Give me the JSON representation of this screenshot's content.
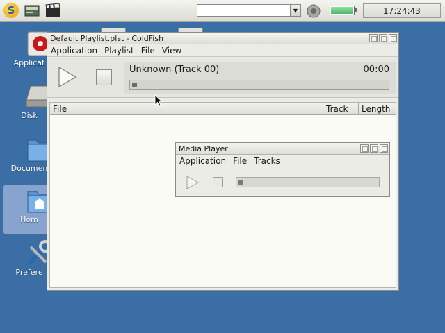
{
  "panel": {
    "clock": "17:24:43",
    "start_logo": "S",
    "combo_value": "",
    "battery_level": 1.0,
    "icons": [
      "start-menu-icon",
      "file-manager-icon",
      "video-clapper-icon",
      "sound-icon",
      "battery-icon"
    ]
  },
  "desktop": {
    "icons": [
      {
        "label": "Applicat",
        "icon": "applications-icon"
      },
      {
        "label": "Disk",
        "icon": "disk-icon"
      },
      {
        "label": "Documen",
        "icon": "documents-folder-icon"
      },
      {
        "label": "Hom",
        "icon": "home-folder-icon"
      },
      {
        "label": "Prefere",
        "icon": "preferences-tools-icon"
      }
    ]
  },
  "main_window": {
    "title": "Default Playlist.plst - ColdFish",
    "menu": [
      "Application",
      "Playlist",
      "File",
      "View"
    ],
    "track_title": "Unknown (Track 00)",
    "track_time": "00:00",
    "seek_progress": 0,
    "columns": [
      "File",
      "Track",
      "Length"
    ]
  },
  "media_window": {
    "title": "Media Player",
    "menu": [
      "Application",
      "File",
      "Tracks"
    ],
    "seek_progress": 0
  },
  "colors": {
    "desktop": "#3a6ea5",
    "window_bg": "#ecece6",
    "list_bg": "#fbfbf6"
  }
}
